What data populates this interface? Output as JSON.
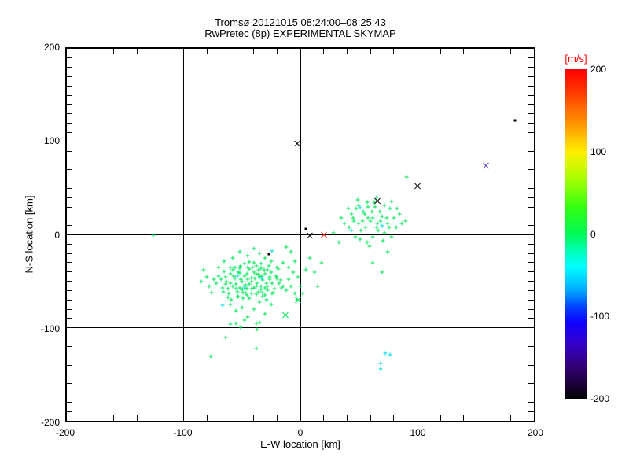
{
  "title": {
    "line1": "Tromsø 20121015 08:24:00–08:25:43",
    "line2": "RwPretec (8p) EXPERIMENTAL SKYMAP"
  },
  "axes": {
    "xlabel": "E-W location [km]",
    "ylabel": "N-S location [km]",
    "xlim": [
      -200,
      200
    ],
    "ylim": [
      -200,
      200
    ],
    "xticks": [
      "-200",
      "-100",
      "0",
      "100",
      "200"
    ],
    "yticks": [
      "200",
      "100",
      "0",
      "-100",
      "-200"
    ],
    "grid": "on",
    "minor_tick_km_x": 20,
    "minor_tick_km_y": 10
  },
  "colorbar": {
    "title": "[m/s]",
    "title_color": "#ff0000",
    "ticks": [
      "200",
      "100",
      "0",
      "-100",
      "-200"
    ],
    "range": [
      200,
      -200
    ],
    "gradient": [
      [
        "#ff0000",
        0
      ],
      [
        "#ff4400",
        8
      ],
      [
        "#ff9900",
        17
      ],
      [
        "#ffee00",
        25
      ],
      [
        "#aaff00",
        33
      ],
      [
        "#33ff11",
        42
      ],
      [
        "#00f958",
        50
      ],
      [
        "#00ffb3",
        55
      ],
      [
        "#00ffff",
        60
      ],
      [
        "#00aaff",
        67
      ],
      [
        "#0044ff",
        72
      ],
      [
        "#1100ff",
        77
      ],
      [
        "#3300cc",
        83
      ],
      [
        "#330077",
        90
      ],
      [
        "#1a0033",
        96
      ],
      [
        "#000000",
        100
      ]
    ]
  },
  "chart_data": {
    "type": "scatter",
    "title": "Tromsø 20121015 08:24:00–08:25:43 / RwPretec (8p) EXPERIMENTAL SKYMAP",
    "xlabel": "E-W location [km]",
    "ylabel": "N-S location [km]",
    "xlim": [
      -200,
      200
    ],
    "ylim": [
      -200,
      200
    ],
    "legend": "colorbar [m/s] from -200 (black) to 200 (red)",
    "series": [
      {
        "name": "echo-points-green",
        "marker": "plus",
        "color": "#00e65a",
        "points": [
          [
            -45,
            -48
          ],
          [
            -52,
            -41
          ],
          [
            -38,
            -55
          ],
          [
            -60,
            -52
          ],
          [
            -33,
            -44
          ],
          [
            -47,
            -62
          ],
          [
            -55,
            -58
          ],
          [
            -41,
            -35
          ],
          [
            -29,
            -52
          ],
          [
            -64,
            -45
          ],
          [
            -50,
            -50
          ],
          [
            -36,
            -61
          ],
          [
            -58,
            -38
          ],
          [
            -44,
            -29
          ],
          [
            -31,
            -38
          ],
          [
            -67,
            -57
          ],
          [
            -53,
            -66
          ],
          [
            -39,
            -47
          ],
          [
            -26,
            -45
          ],
          [
            -61,
            -63
          ],
          [
            -48,
            -55
          ],
          [
            -34,
            -31
          ],
          [
            -56,
            -47
          ],
          [
            -42,
            -58
          ],
          [
            -28,
            -60
          ],
          [
            -65,
            -39
          ],
          [
            -51,
            -33
          ],
          [
            -37,
            -52
          ],
          [
            -24,
            -52
          ],
          [
            -59,
            -70
          ],
          [
            -46,
            -42
          ],
          [
            -32,
            -66
          ],
          [
            -54,
            -61
          ],
          [
            -40,
            -40
          ],
          [
            -27,
            -33
          ],
          [
            -63,
            -50
          ],
          [
            -49,
            -68
          ],
          [
            -35,
            -45
          ],
          [
            -22,
            -58
          ],
          [
            -57,
            -44
          ],
          [
            -44,
            -53
          ],
          [
            -30,
            -57
          ],
          [
            -52,
            -36
          ],
          [
            -38,
            -64
          ],
          [
            -25,
            -40
          ],
          [
            -62,
            -67
          ],
          [
            -48,
            -31
          ],
          [
            -34,
            -55
          ],
          [
            -20,
            -47
          ],
          [
            -55,
            -53
          ],
          [
            -42,
            -46
          ],
          [
            -68,
            -48
          ],
          [
            -50,
            -59
          ],
          [
            -36,
            -38
          ],
          [
            -23,
            -62
          ],
          [
            -60,
            -42
          ],
          [
            -46,
            -65
          ],
          [
            -32,
            -49
          ],
          [
            -18,
            -52
          ],
          [
            -53,
            -40
          ],
          [
            -40,
            -57
          ],
          [
            -66,
            -61
          ],
          [
            -48,
            -44
          ],
          [
            -34,
            -36
          ],
          [
            -21,
            -44
          ],
          [
            -58,
            -55
          ],
          [
            -44,
            -68
          ],
          [
            -30,
            -42
          ],
          [
            -16,
            -57
          ],
          [
            -51,
            -48
          ],
          [
            -38,
            -33
          ],
          [
            -64,
            -53
          ],
          [
            -46,
            -58
          ],
          [
            -32,
            -62
          ],
          [
            -19,
            -37
          ],
          [
            -56,
            -35
          ],
          [
            -42,
            -50
          ],
          [
            -28,
            -55
          ],
          [
            -70,
            -44
          ],
          [
            -49,
            -62
          ],
          [
            -36,
            -43
          ],
          [
            -62,
            -58
          ],
          [
            -44,
            -37
          ],
          [
            -30,
            -65
          ],
          [
            -17,
            -49
          ],
          [
            -54,
            -66
          ],
          [
            -40,
            -30
          ],
          [
            -26,
            -48
          ],
          [
            -72,
            -52
          ],
          [
            -47,
            -54
          ],
          [
            -34,
            -59
          ],
          [
            -60,
            -35
          ],
          [
            -42,
            -63
          ],
          [
            -28,
            -38
          ],
          [
            -15,
            -55
          ],
          [
            -52,
            -57
          ],
          [
            -38,
            -42
          ],
          [
            -24,
            -63
          ],
          [
            -74,
            -48
          ],
          [
            -45,
            -35
          ],
          [
            -80,
            -45
          ],
          [
            -83,
            -38
          ],
          [
            -78,
            -55
          ],
          [
            -85,
            -50
          ],
          [
            -76,
            -62
          ],
          [
            -12,
            -60
          ],
          [
            -10,
            -48
          ],
          [
            -8,
            -55
          ],
          [
            -5,
            -63
          ],
          [
            -3,
            -70
          ],
          [
            -58,
            -25
          ],
          [
            -45,
            -22
          ],
          [
            -35,
            -20
          ],
          [
            -52,
            -18
          ],
          [
            -40,
            -15
          ],
          [
            -30,
            -25
          ],
          [
            -25,
            -28
          ],
          [
            -65,
            -28
          ],
          [
            -70,
            -35
          ],
          [
            -20,
            -35
          ],
          [
            -60,
            -75
          ],
          [
            -50,
            -78
          ],
          [
            -40,
            -80
          ],
          [
            -35,
            -72
          ],
          [
            -55,
            -82
          ],
          [
            -45,
            -88
          ],
          [
            -30,
            -85
          ],
          [
            -25,
            -75
          ],
          [
            -48,
            -92
          ],
          [
            -38,
            -95
          ],
          [
            -15,
            -30
          ],
          [
            -10,
            -35
          ],
          [
            -5,
            -28
          ],
          [
            -8,
            -18
          ],
          [
            -2,
            -45
          ],
          [
            0,
            -55
          ],
          [
            2,
            -63
          ],
          [
            -6,
            -40
          ],
          [
            8,
            -25
          ],
          [
            12,
            -40
          ],
          [
            15,
            -55
          ],
          [
            5,
            -38
          ],
          [
            -12,
            -13
          ],
          [
            18,
            -30
          ],
          [
            -64,
            -110
          ],
          [
            -38,
            -122
          ],
          [
            -77,
            -131
          ],
          [
            -60,
            -96
          ],
          [
            -55,
            -95
          ],
          [
            -51,
            -99
          ],
          [
            -35,
            -94
          ],
          [
            -37,
            -102
          ],
          [
            -29,
            -70
          ],
          [
            -126,
            0
          ],
          [
            60,
            15
          ],
          [
            55,
            22
          ],
          [
            65,
            8
          ],
          [
            50,
            12
          ],
          [
            70,
            20
          ],
          [
            58,
            30
          ],
          [
            45,
            18
          ],
          [
            62,
            -2
          ],
          [
            75,
            12
          ],
          [
            52,
            5
          ],
          [
            68,
            25
          ],
          [
            48,
            28
          ],
          [
            57,
            -8
          ],
          [
            72,
            2
          ],
          [
            80,
            18
          ],
          [
            42,
            8
          ],
          [
            63,
            35
          ],
          [
            53,
            15
          ],
          [
            77,
            28
          ],
          [
            47,
            -2
          ],
          [
            66,
            12
          ],
          [
            58,
            18
          ],
          [
            71,
            -6
          ],
          [
            44,
            22
          ],
          [
            82,
            8
          ],
          [
            50,
            32
          ],
          [
            61,
            25
          ],
          [
            69,
            15
          ],
          [
            38,
            12
          ],
          [
            85,
            22
          ],
          [
            56,
            8
          ],
          [
            64,
            30
          ],
          [
            74,
            18
          ],
          [
            49,
            38
          ],
          [
            59,
            -12
          ],
          [
            67,
            5
          ],
          [
            78,
            -2
          ],
          [
            41,
            28
          ],
          [
            87,
            12
          ],
          [
            54,
            25
          ],
          [
            62,
            18
          ],
          [
            72,
            32
          ],
          [
            46,
            15
          ],
          [
            83,
            28
          ],
          [
            51,
            -5
          ],
          [
            90,
            15
          ],
          [
            35,
            18
          ],
          [
            65,
            40
          ],
          [
            57,
            35
          ],
          [
            76,
            8
          ],
          [
            78,
            36
          ],
          [
            91,
            62
          ],
          [
            75,
            -18
          ],
          [
            62,
            -30
          ],
          [
            70,
            -40
          ],
          [
            28,
            2
          ],
          [
            33,
            -8
          ]
        ]
      },
      {
        "name": "echo-points-cyan",
        "marker": "plus",
        "color": "#00dce0",
        "points": [
          [
            -67,
            -76
          ],
          [
            -24,
            -17
          ],
          [
            51,
            29
          ],
          [
            70,
            10
          ],
          [
            -33,
            -47
          ],
          [
            -48,
            -57
          ],
          [
            73,
            -127
          ],
          [
            77,
            -129
          ],
          [
            69,
            -138
          ],
          [
            69,
            -144
          ],
          [
            44,
            5
          ],
          [
            -54,
            -44
          ]
        ]
      },
      {
        "name": "cross-markers-black",
        "marker": "x",
        "color": "#000000",
        "points": [
          [
            -3,
            98
          ],
          [
            8,
            -1
          ],
          [
            66,
            36
          ],
          [
            100,
            52
          ]
        ]
      },
      {
        "name": "cross-marker-red",
        "marker": "x",
        "color": "#ee1500",
        "points": [
          [
            20,
            0
          ]
        ]
      },
      {
        "name": "cross-marker-blue",
        "marker": "x",
        "color": "#5236c2",
        "points": [
          [
            159,
            74
          ]
        ]
      },
      {
        "name": "cross-markers-green",
        "marker": "x",
        "color": "#00e65a",
        "points": [
          [
            -2,
            -71
          ],
          [
            -13,
            -87
          ]
        ]
      },
      {
        "name": "dot-markers-black",
        "marker": "dot",
        "color": "#000000",
        "points": [
          [
            184,
            123
          ],
          [
            5,
            6
          ],
          [
            -27,
            -21
          ]
        ]
      }
    ]
  }
}
